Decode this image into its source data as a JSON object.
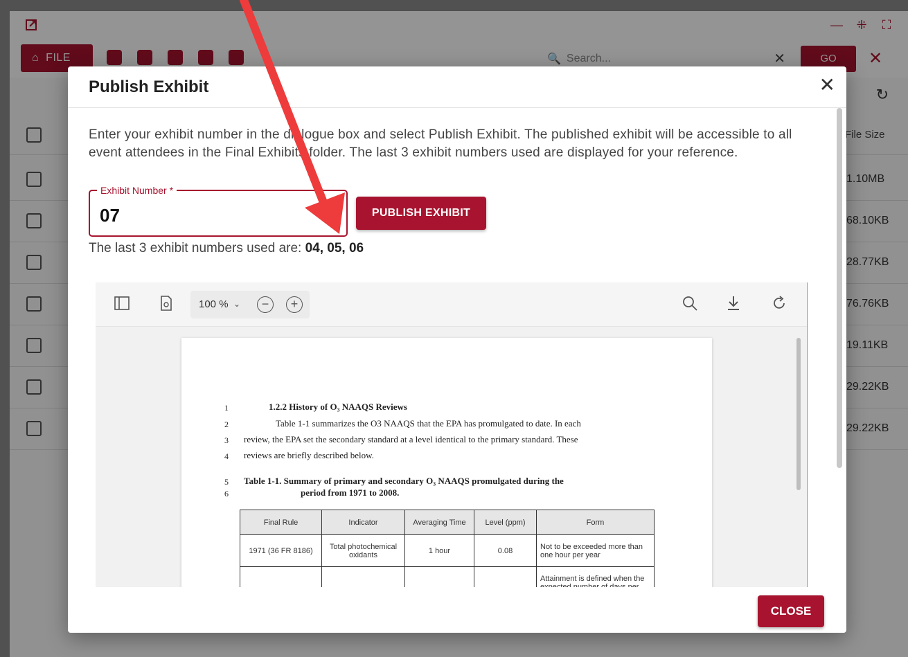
{
  "window": {
    "controls": [
      "—",
      "⁜",
      "⛶"
    ],
    "file_label": "FILE",
    "search_placeholder": "Search...",
    "go_label": "GO",
    "close_glyph": "✕",
    "refresh_glyph": "↻"
  },
  "files": {
    "header_size": "File Size",
    "sizes": [
      "1.10MB",
      "68.10KB",
      "28.77KB",
      "76.76KB",
      "19.11KB",
      "29.22KB",
      "29.22KB"
    ]
  },
  "modal": {
    "title": "Publish Exhibit",
    "instructions": "Enter your exhibit number in the dialogue box and select Publish Exhibit. The published exhibit will be accessible to all event attendees in the Final Exhibits folder.  The last 3 exhibit numbers used are displayed for your reference.",
    "field_label": "Exhibit Number *",
    "field_value": "07",
    "publish_label": "PUBLISH EXHIBIT",
    "last_used_prefix": "The last 3 exhibit numbers used are: ",
    "last_used_values": "04, 05, 06",
    "close_label": "CLOSE"
  },
  "viewer": {
    "zoom": "100 %"
  },
  "document": {
    "lines": [
      {
        "num": "1",
        "text": "1.2.2    History of O₃ NAAQS Reviews"
      },
      {
        "num": "2",
        "text": "Table 1-1 summarizes the O3 NAAQS that the EPA has promulgated to date. In each"
      },
      {
        "num": "3",
        "text": "review, the EPA set the secondary standard at a level identical to the primary standard. These"
      },
      {
        "num": "4",
        "text": "reviews are briefly described below."
      },
      {
        "num": "5",
        "text": "Table 1-1.    Summary of primary and secondary O₃ NAAQS promulgated during the"
      },
      {
        "num": "6",
        "text": "period from 1971 to 2008."
      }
    ],
    "table_headers": [
      "Final Rule",
      "Indicator",
      "Averaging Time",
      "Level (ppm)",
      "Form"
    ],
    "table_row1": [
      "1971 (36 FR 8186)",
      "Total photochemical oxidants",
      "1 hour",
      "0.08",
      "Not to be exceeded more than one hour per year"
    ],
    "table_row2": [
      "",
      "",
      "",
      "",
      "Attainment is defined when the expected number of days per"
    ]
  }
}
